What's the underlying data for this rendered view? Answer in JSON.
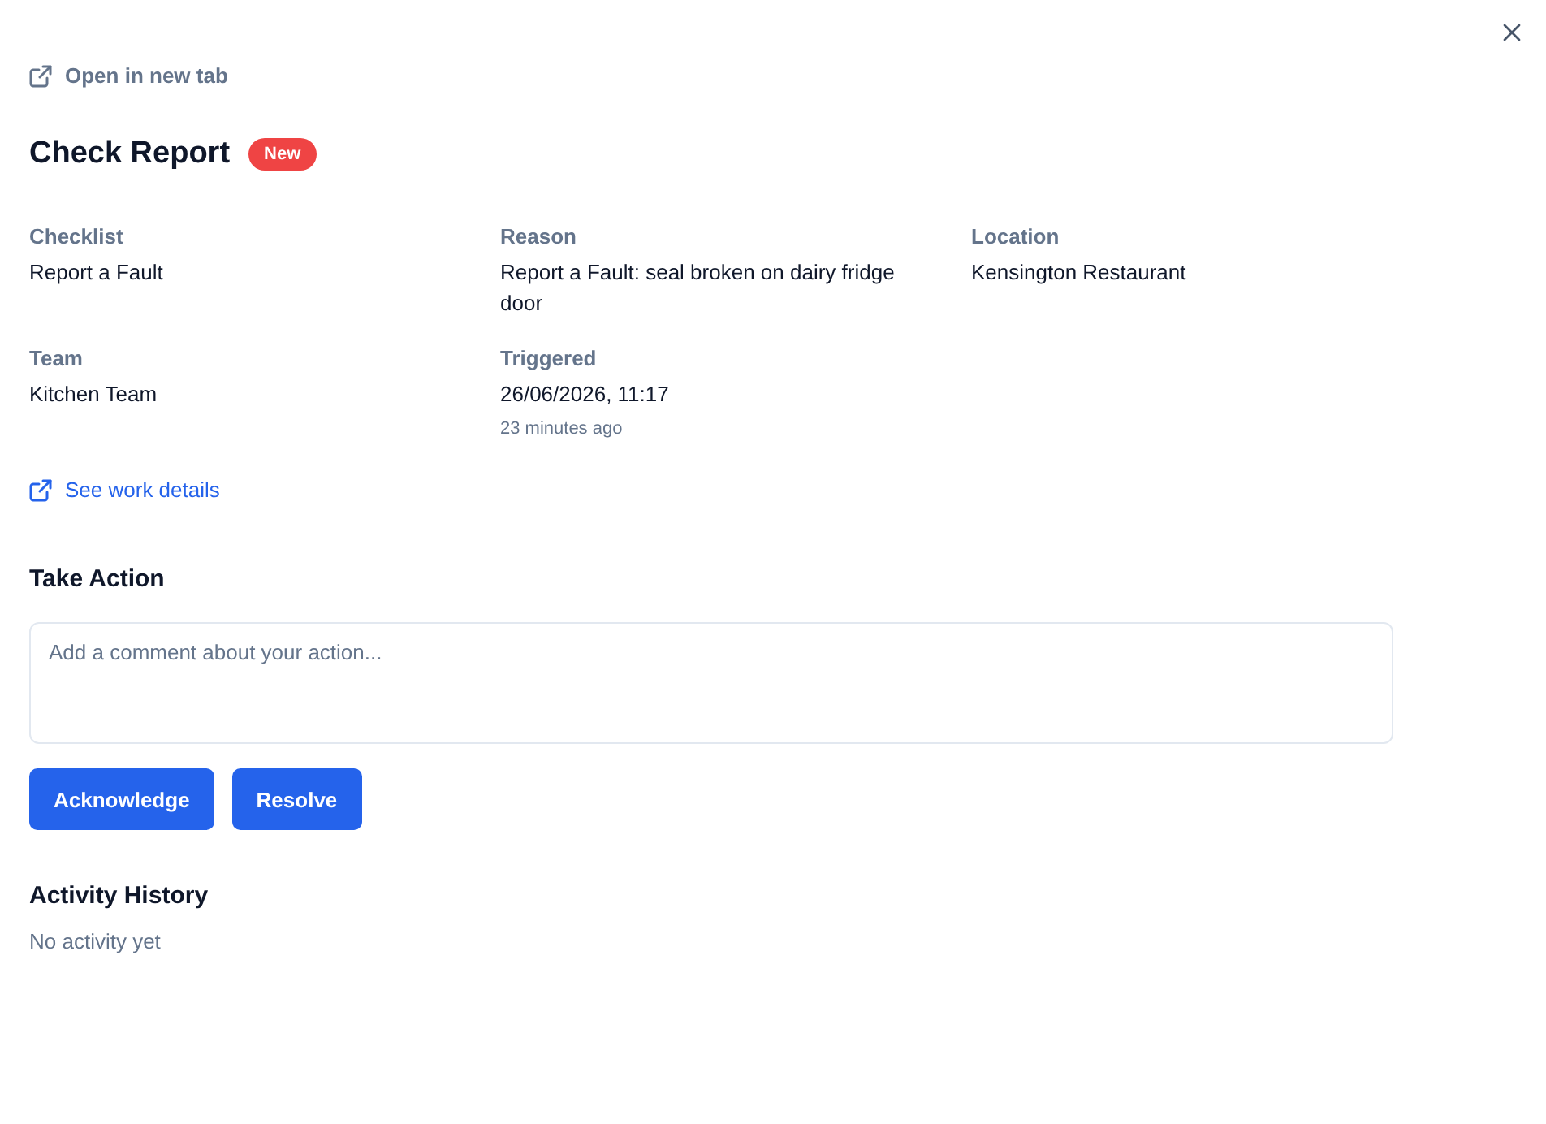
{
  "open_link": {
    "label": "Open in new tab"
  },
  "header": {
    "title": "Check Report",
    "badge": "New"
  },
  "fields": [
    {
      "label": "Checklist",
      "value": "Report a Fault"
    },
    {
      "label": "Reason",
      "value": "Report a Fault: seal broken on dairy fridge door"
    },
    {
      "label": "Location",
      "value": "Kensington Restaurant"
    },
    {
      "label": "Team",
      "value": "Kitchen Team"
    },
    {
      "label": "Triggered",
      "value": "26/06/2026, 11:17",
      "note": "23 minutes ago"
    }
  ],
  "details_link": {
    "label": "See work details"
  },
  "take_action": {
    "title": "Take Action",
    "comment": {
      "placeholder": "Add a comment about your action..."
    },
    "buttons": [
      "Acknowledge",
      "Resolve"
    ]
  },
  "activity": {
    "title": "Activity History",
    "empty_text": "No activity yet"
  }
}
